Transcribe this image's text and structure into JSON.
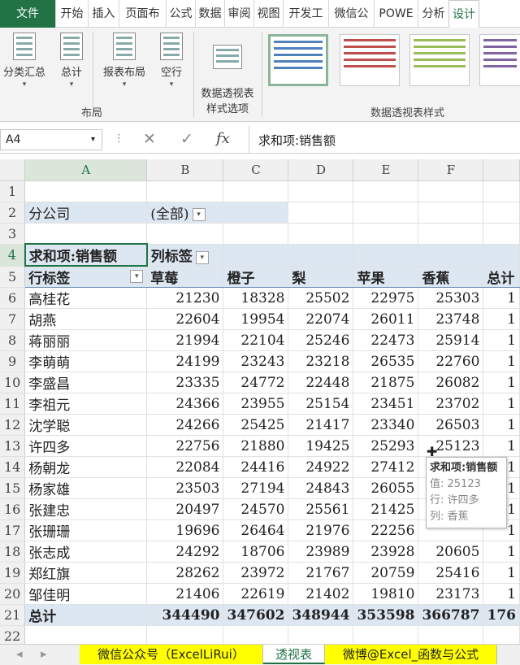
{
  "ribbon_tabs": [
    "文件",
    "开始",
    "插入",
    "页面布",
    "公式",
    "数据",
    "审阅",
    "视图",
    "开发工",
    "微信公",
    "POWE",
    "分析",
    "设计"
  ],
  "ribbon": {
    "buttons": [
      "分类汇总",
      "总计",
      "报表布局",
      "空行",
      "数据透视表\n样式选项"
    ],
    "groups": {
      "layout": "布局",
      "styles": "数据透视表样式"
    },
    "swatch_colors": [
      "#4f81bd",
      "#c0504d",
      "#9bbb59",
      "#8064a2"
    ]
  },
  "formula_bar": {
    "namebox": "A4",
    "content": "求和项:销售额",
    "fx": "fx"
  },
  "grid": {
    "col_headers": [
      "A",
      "B",
      "C",
      "D",
      "E",
      "F",
      ""
    ],
    "row_numbers": [
      "1",
      "2",
      "3",
      "4",
      "5",
      "6",
      "7",
      "8",
      "9",
      "10",
      "11",
      "12",
      "13",
      "14",
      "15",
      "16",
      "17",
      "18",
      "19",
      "20",
      "21",
      "22"
    ],
    "filter_label": "分公司",
    "filter_value": "(全部)",
    "value_label": "求和项:销售额",
    "col_label": "列标签",
    "row_label": "行标签",
    "fruits": [
      "草莓",
      "橙子",
      "梨",
      "苹果",
      "香蕉",
      "总计"
    ],
    "rows": [
      {
        "name": "高桂花",
        "v": [
          "21230",
          "18328",
          "25502",
          "22975",
          "25303",
          "1"
        ]
      },
      {
        "name": "胡燕",
        "v": [
          "22604",
          "19954",
          "22074",
          "26011",
          "23748",
          "1"
        ]
      },
      {
        "name": "蒋丽丽",
        "v": [
          "21994",
          "22104",
          "25246",
          "22473",
          "25914",
          "1"
        ]
      },
      {
        "name": "李萌萌",
        "v": [
          "24199",
          "23243",
          "23218",
          "26535",
          "22760",
          "1"
        ]
      },
      {
        "name": "李盛昌",
        "v": [
          "23335",
          "24772",
          "22448",
          "21875",
          "26082",
          "1"
        ]
      },
      {
        "name": "李祖元",
        "v": [
          "24366",
          "23955",
          "25154",
          "23451",
          "23702",
          "1"
        ]
      },
      {
        "name": "沈学聪",
        "v": [
          "24266",
          "25425",
          "21417",
          "23340",
          "26503",
          "1"
        ]
      },
      {
        "name": "许四多",
        "v": [
          "22756",
          "21880",
          "19425",
          "25293",
          "25123",
          "1"
        ]
      },
      {
        "name": "杨朝龙",
        "v": [
          "22084",
          "24416",
          "24922",
          "27412",
          "",
          "1"
        ]
      },
      {
        "name": "杨家雄",
        "v": [
          "23503",
          "27194",
          "24843",
          "26055",
          "",
          "1"
        ]
      },
      {
        "name": "张建忠",
        "v": [
          "20497",
          "24570",
          "25561",
          "21425",
          "",
          "1"
        ]
      },
      {
        "name": "张珊珊",
        "v": [
          "19696",
          "26464",
          "21976",
          "22256",
          "",
          "1"
        ]
      },
      {
        "name": "张志成",
        "v": [
          "24292",
          "18706",
          "23989",
          "23928",
          "20605",
          "1"
        ]
      },
      {
        "name": "郑红旗",
        "v": [
          "28262",
          "23972",
          "21767",
          "20759",
          "25416",
          "1"
        ]
      },
      {
        "name": "邹佳明",
        "v": [
          "21406",
          "22619",
          "21402",
          "19810",
          "23173",
          "1"
        ]
      }
    ],
    "total": {
      "name": "总计",
      "v": [
        "344490",
        "347602",
        "348944",
        "353598",
        "366787",
        "176"
      ]
    }
  },
  "tooltip": {
    "title": "求和项:销售额",
    "value": "值: 25123",
    "row": "行: 许四多",
    "col": "列: 香蕉"
  },
  "sheet_tabs": [
    "微信公众号（ExcelLiRui）",
    "透视表",
    "微博@Excel_函数与公式"
  ]
}
